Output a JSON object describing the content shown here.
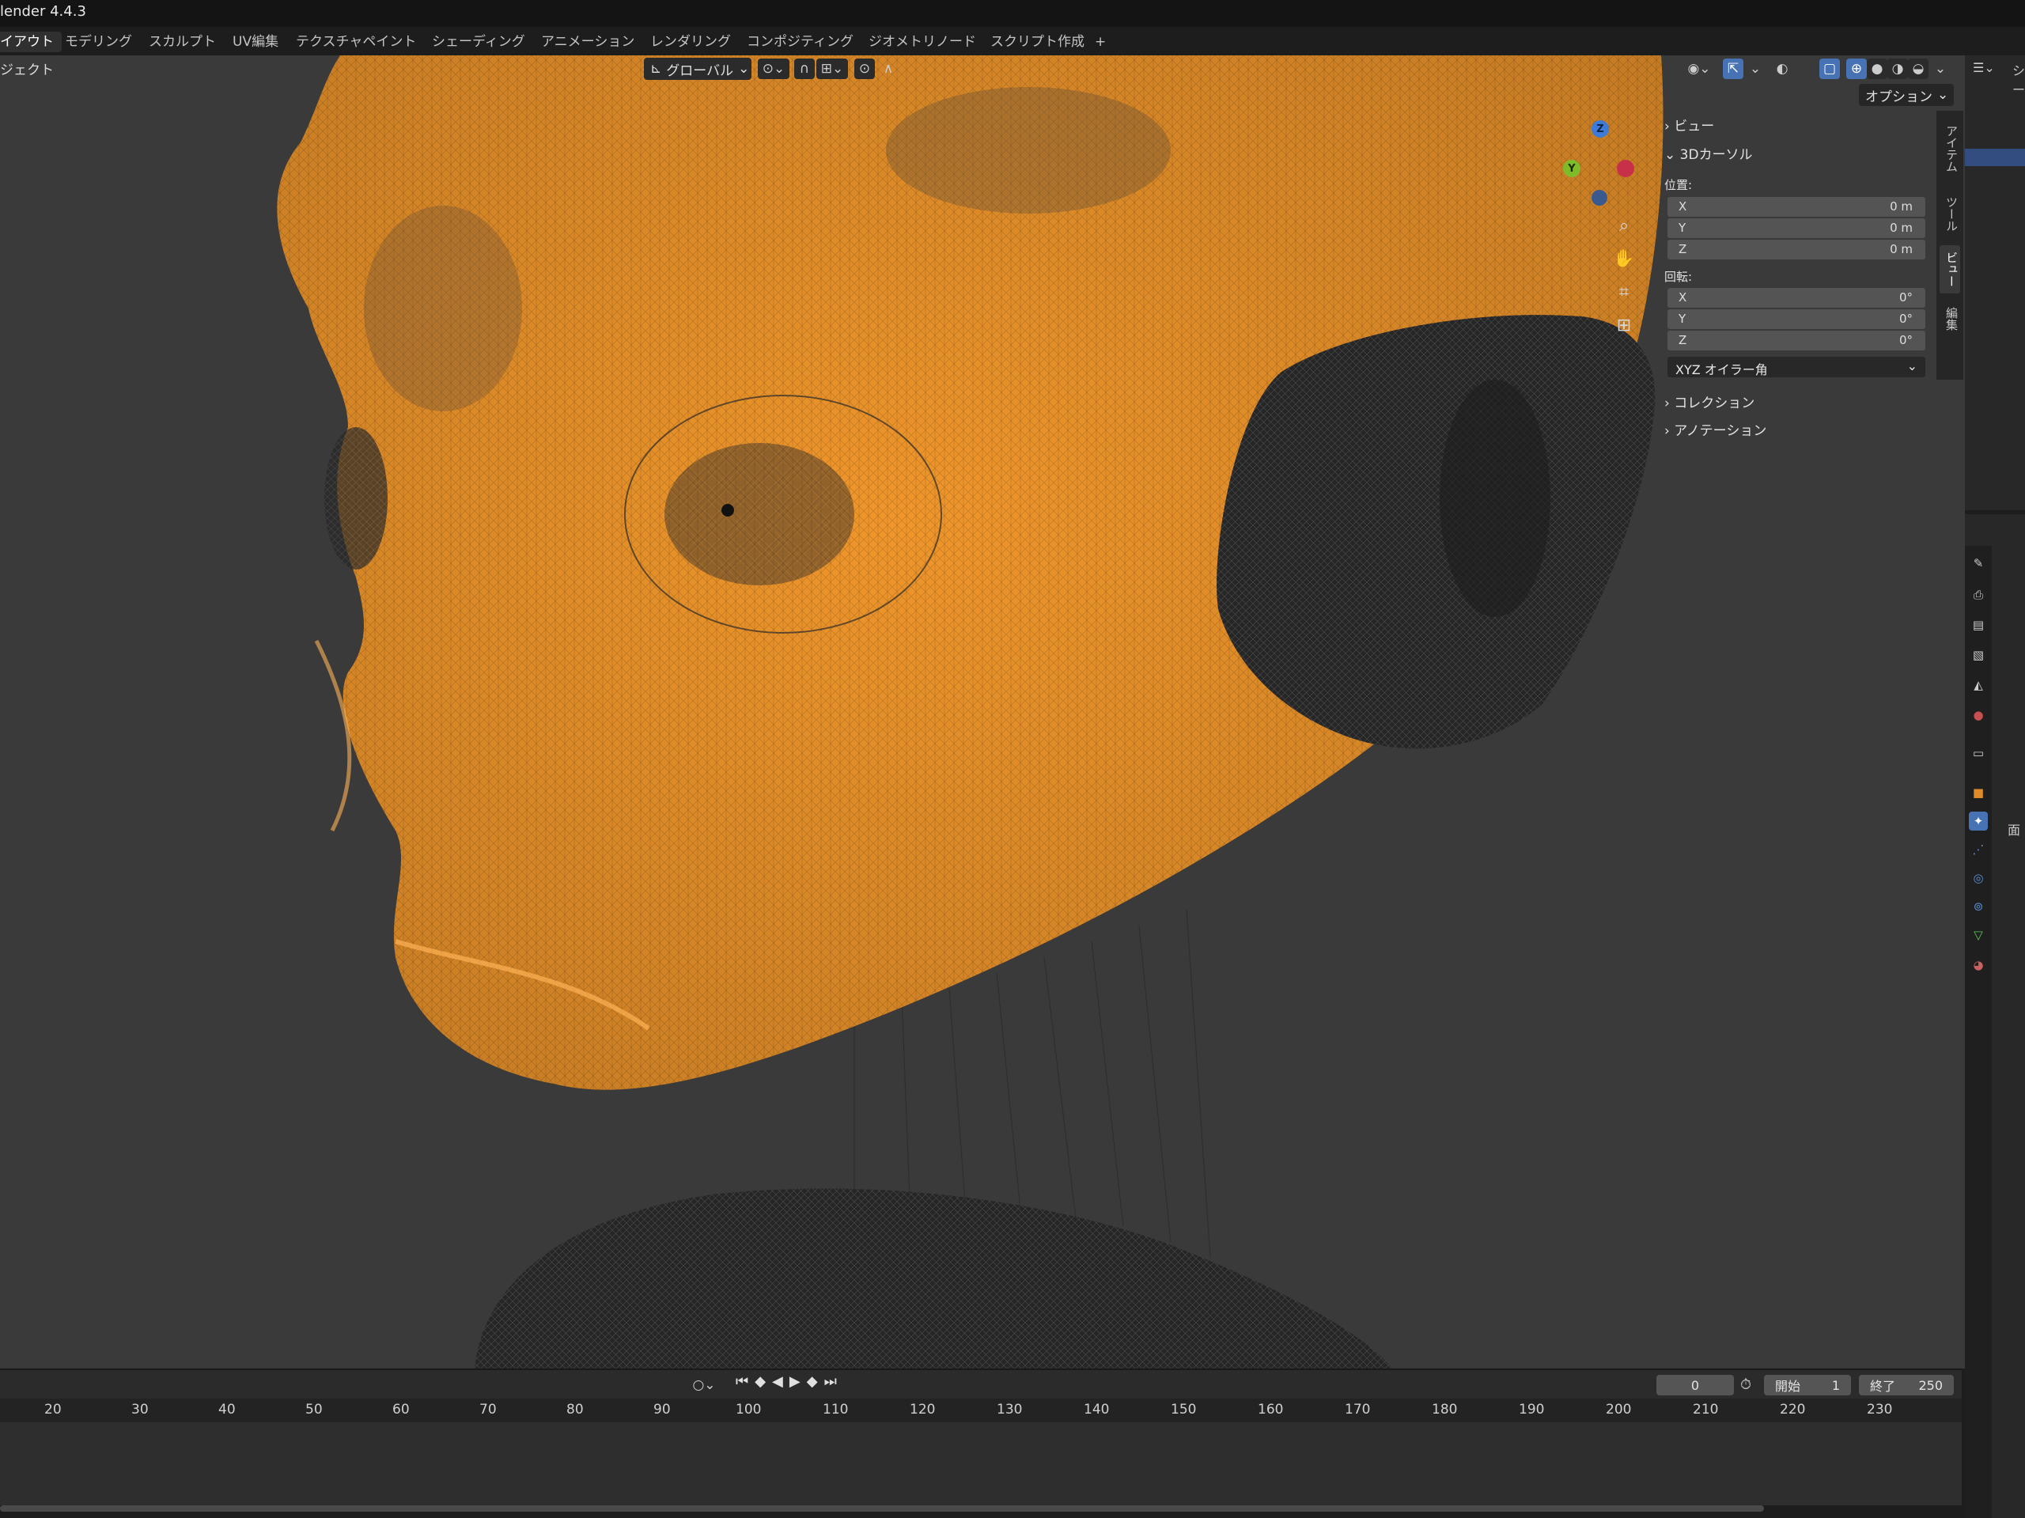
{
  "app": {
    "title": "lender 4.4.3"
  },
  "workspace_tabs": [
    {
      "label": "イアウト"
    },
    {
      "label": "モデリング"
    },
    {
      "label": "スカルプト"
    },
    {
      "label": "UV編集"
    },
    {
      "label": "テクスチャペイント"
    },
    {
      "label": "シェーディング"
    },
    {
      "label": "アニメーション"
    },
    {
      "label": "レンダリング"
    },
    {
      "label": "コンポジティング"
    },
    {
      "label": "ジオメトリノード"
    },
    {
      "label": "スクリプト作成"
    },
    {
      "label": "+"
    }
  ],
  "viewport_header": {
    "menu_fragment": "ジェクト",
    "transform_orientation": "グローバル",
    "options_label": "オプション"
  },
  "npanel": {
    "sections": {
      "view": "ビュー",
      "cursor3d": "3Dカーソル",
      "collection": "コレクション",
      "annotation": "アノテーション"
    },
    "location_label": "位置:",
    "location": [
      {
        "axis": "X",
        "value": "0 m"
      },
      {
        "axis": "Y",
        "value": "0 m"
      },
      {
        "axis": "Z",
        "value": "0 m"
      }
    ],
    "rotation_label": "回転:",
    "rotation": [
      {
        "axis": "X",
        "value": "0°"
      },
      {
        "axis": "Y",
        "value": "0°"
      },
      {
        "axis": "Z",
        "value": "0°"
      }
    ],
    "rotation_mode": "XYZ オイラー角"
  },
  "sidebar_tabs": [
    "アイテム",
    "ツール",
    "ビュー",
    "編集"
  ],
  "gizmo": {
    "z": "Z",
    "y": "Y"
  },
  "timeline": {
    "current_frame": "0",
    "start_label": "開始",
    "start_value": "1",
    "end_label": "終了",
    "end_value": "250",
    "ticks": [
      "20",
      "30",
      "40",
      "50",
      "60",
      "70",
      "80",
      "90",
      "100",
      "110",
      "120",
      "130",
      "140",
      "150",
      "160",
      "170",
      "180",
      "190",
      "200",
      "210",
      "220",
      "230"
    ]
  },
  "outliner_fragment": "シー",
  "properties_fragment": "面",
  "colors": {
    "viewport_bg": "#3a3a3a",
    "selected_wire": "#f29a2e",
    "accent": "#4772b3"
  }
}
